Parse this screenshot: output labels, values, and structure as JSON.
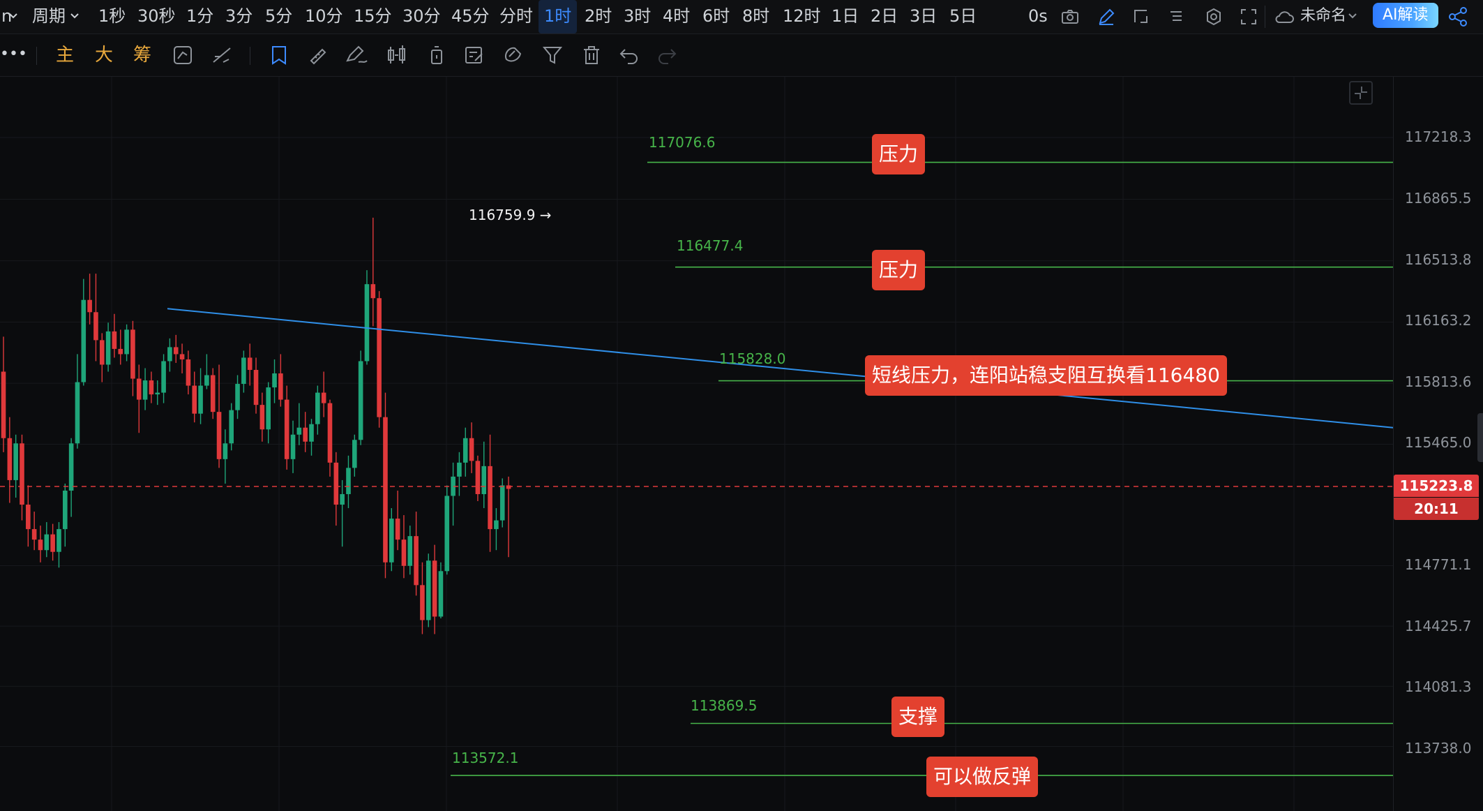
{
  "topbar": {
    "left_fragment": "n",
    "period_label": "周期",
    "intervals": [
      "1秒",
      "30秒",
      "1分",
      "3分",
      "5分",
      "10分",
      "15分",
      "30分",
      "45分",
      "分时",
      "1时",
      "2时",
      "3时",
      "4时",
      "6时",
      "8时",
      "12时",
      "1日",
      "2日",
      "3日",
      "5日"
    ],
    "active_interval": "1时",
    "latency": "0s",
    "layout_name": "未命名",
    "ai_button": "AI解读"
  },
  "toolbar": {
    "more": "•••",
    "indicators": [
      "主",
      "大",
      "筹"
    ]
  },
  "chart": {
    "y_ticks": [
      "117218.3",
      "116865.5",
      "116513.8",
      "116163.2",
      "115813.6",
      "115465.0",
      "114771.1",
      "114425.7",
      "114081.3",
      "113738.0"
    ],
    "current_price": "115223.8",
    "countdown": "20:11",
    "high_marker": "116759.9",
    "levels": [
      {
        "value": "117076.6",
        "note": "压力"
      },
      {
        "value": "116477.4",
        "note": "压力"
      },
      {
        "value": "115828.0",
        "note": "短线压力，连阳站稳支阻互换看116480"
      },
      {
        "value": "113869.5",
        "note": "支撑"
      },
      {
        "value": "113572.1",
        "note": "可以做反弹"
      }
    ],
    "colors": {
      "up": "#1fa67a",
      "down": "#e0393b",
      "level": "#47b54a",
      "trend": "#2f8fe8",
      "note_bg": "#e3412f"
    }
  }
}
